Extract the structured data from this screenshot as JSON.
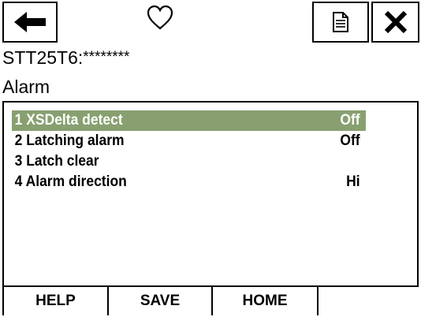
{
  "header": {
    "back_icon": "arrow-left-icon",
    "favorite_icon": "heart-outline-icon",
    "document_icon": "document-icon",
    "close_icon": "close-icon"
  },
  "device": {
    "tag_prefix": "STT25T6:",
    "tag_masked": "********"
  },
  "section": {
    "title": "Alarm"
  },
  "menu": {
    "items": [
      {
        "label": "1 XSDelta detect",
        "value": "Off",
        "selected": true
      },
      {
        "label": "2 Latching alarm",
        "value": "Off",
        "selected": false
      },
      {
        "label": "3 Latch clear",
        "value": "",
        "selected": false
      },
      {
        "label": "4 Alarm direction",
        "value": "Hi",
        "selected": false
      }
    ]
  },
  "footer": {
    "help_label": "HELP",
    "save_label": "SAVE",
    "home_label": "HOME"
  },
  "colors": {
    "selection": "#88a070"
  }
}
